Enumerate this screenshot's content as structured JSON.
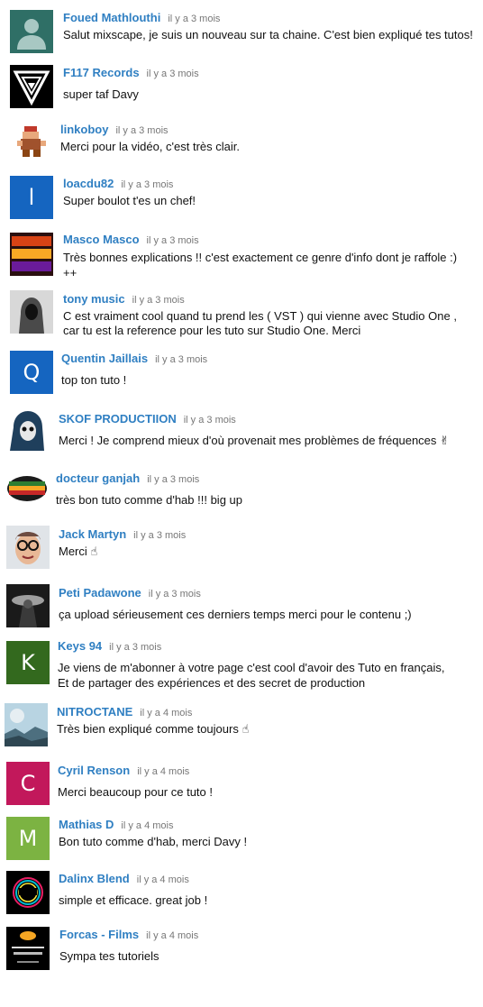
{
  "comments": [
    {
      "author": "Foued Mathlouthi",
      "time": "il y a 3 mois",
      "text": "Salut mixscape, je suis un nouveau sur ta chaine. C'est bien expliqué tes tutos!",
      "avatar": {
        "type": "default-user-icon",
        "color": "#2f6f66"
      }
    },
    {
      "author": "F117 Records",
      "time": "il y a 3 mois",
      "text": "super taf Davy",
      "avatar": {
        "type": "f117-logo-icon",
        "color": "#000000"
      }
    },
    {
      "author": "linkoboy",
      "time": "il y a 3 mois",
      "text": "Merci pour la vidéo, c'est très clair.",
      "avatar": {
        "type": "pixel-character-icon",
        "color": "#ffffff"
      }
    },
    {
      "author": "loacdu82",
      "time": "il y a 3 mois",
      "text": "Super boulot t'es un chef!",
      "avatar": {
        "type": "letter",
        "letter": "l",
        "color": "#1565c0"
      }
    },
    {
      "author": "Masco Masco",
      "time": "il y a 3 mois",
      "text_lines": [
        "Très bonnes explications !! c'est exactement ce genre d'info dont je raffole :)",
        "++"
      ],
      "avatar": {
        "type": "masco-logo-icon",
        "color": "#2a0f0f"
      }
    },
    {
      "author": "tony music",
      "time": "il y a 3 mois",
      "text_lines": [
        "C est vraiment cool quand tu prend les ( VST ) qui vienne avec Studio One ,",
        "car tu est la reference pour les tuto sur Studio One. Merci"
      ],
      "avatar": {
        "type": "hooded-figure-icon",
        "color": "#cfcfcf"
      }
    },
    {
      "author": "Quentin Jaillais",
      "time": "il y a 3 mois",
      "text": "top ton tuto !",
      "avatar": {
        "type": "letter",
        "letter": "Q",
        "color": "#1565c0"
      }
    },
    {
      "author": "SKOF PRODUCTIION",
      "time": "il y a 3 mois",
      "text": "Merci ! Je comprend mieux d'où provenait mes problèmes de fréquences ✌",
      "avatar": {
        "type": "reaper-icon",
        "color": "#ffffff"
      }
    },
    {
      "author": "docteur ganjah",
      "time": "il y a 3 mois",
      "text": "très bon tuto comme d'hab !!! big up",
      "avatar": {
        "type": "ganjah-logo-icon",
        "color": "#ffffff"
      }
    },
    {
      "author": "Jack Martyn",
      "time": "il y a 3 mois",
      "text": "Merci ☝",
      "avatar": {
        "type": "face-photo-icon",
        "color": "#2b3a4a"
      }
    },
    {
      "author": "Peti Padawone",
      "time": "il y a 3 mois",
      "text": "ça upload sérieusement ces derniers temps merci pour le contenu ;)",
      "avatar": {
        "type": "dark-figure-icon",
        "color": "#1a1a1a"
      }
    },
    {
      "author": "Keys 94",
      "time": "il y a 3 mois",
      "text_lines": [
        "Je viens de m'abonner à votre page c'est cool d'avoir des Tuto en français,",
        "Et de partager des expériences et des secret de production"
      ],
      "avatar": {
        "type": "letter",
        "letter": "K",
        "color": "#33691e"
      }
    },
    {
      "author": "NITROCTANE",
      "time": "il y a 4 mois",
      "text": "Très bien expliqué comme toujours ☝",
      "avatar": {
        "type": "planet-landscape-icon",
        "color": "#9fc3d6"
      }
    },
    {
      "author": "Cyril Renson",
      "time": "il y a 4 mois",
      "text": "Merci beaucoup pour ce tuto !",
      "avatar": {
        "type": "letter",
        "letter": "C",
        "color": "#c2185b"
      }
    },
    {
      "author": "Mathias D",
      "time": "il y a 4 mois",
      "text": "Bon tuto comme d'hab, merci Davy !",
      "avatar": {
        "type": "letter",
        "letter": "M",
        "color": "#7cb342"
      }
    },
    {
      "author": "Dalinx Blend",
      "time": "il y a 4 mois",
      "text": "simple et efficace. great job !",
      "avatar": {
        "type": "db-logo-icon",
        "color": "#000000"
      }
    },
    {
      "author": "Forcas - Films",
      "time": "il y a 4 mois",
      "text": "Sympa tes tutoriels",
      "avatar": {
        "type": "forcas-logo-icon",
        "color": "#000000"
      }
    }
  ]
}
